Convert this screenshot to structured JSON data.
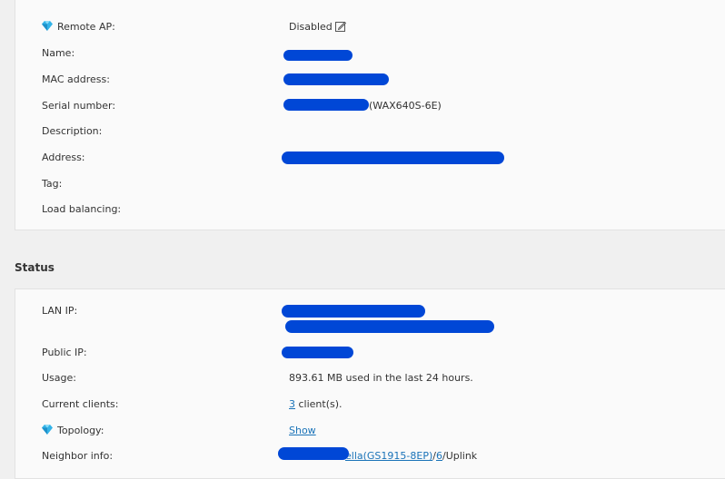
{
  "info": {
    "remote_ap_label": "Remote AP:",
    "remote_ap_value": "Disabled",
    "name_label": "Name:",
    "mac_label": "MAC address:",
    "serial_label": "Serial number:",
    "serial_model": "(WAX640S-6E)",
    "description_label": "Description:",
    "address_label": "Address:",
    "tag_label": "Tag:",
    "load_balancing_label": "Load balancing:"
  },
  "status": {
    "title": "Status",
    "lan_ip_label": "LAN IP:",
    "public_ip_label": "Public IP:",
    "usage_label": "Usage:",
    "usage_value": "893.61 MB used in the last 24 hours.",
    "clients_label": "Current clients:",
    "clients_count": "3",
    "clients_suffix": " client(s).",
    "topology_label": "Topology:",
    "topology_link": "Show",
    "neighbor_label": "Neighbor info:",
    "neighbor_device": "ella(GS1915-8EP)",
    "neighbor_sep": "/",
    "neighbor_port": "6",
    "neighbor_suffix": "/Uplink"
  },
  "colors": {
    "link": "#1a73b8",
    "gem": "#33b3e8",
    "redaction": "#0047d6"
  },
  "icons": [
    "gem-icon",
    "edit-icon"
  ]
}
